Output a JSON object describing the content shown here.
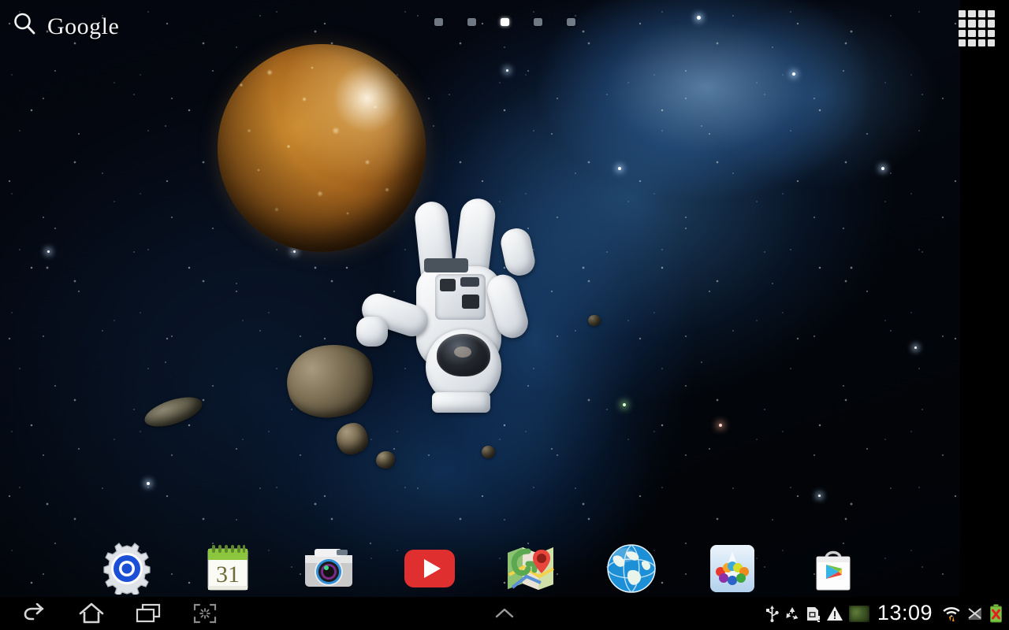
{
  "wallpaper": {
    "name": "space-astronaut-live-wallpaper",
    "scene_elements": [
      "blue-nebula",
      "star-field",
      "cratered-golden-moon",
      "floating-astronaut",
      "asteroids"
    ]
  },
  "search_widget": {
    "icon": "search-icon",
    "brand": "Google"
  },
  "home": {
    "page_count": 5,
    "active_page": 3,
    "apps_button_icon": "apps-grid-icon"
  },
  "dock": {
    "apps": [
      {
        "label": "Settings",
        "icon": "settings-gear-icon"
      },
      {
        "label": "S Planner",
        "icon": "calendar-icon",
        "day": "31"
      },
      {
        "label": "Camera",
        "icon": "camera-icon"
      },
      {
        "label": "YouTube",
        "icon": "youtube-icon"
      },
      {
        "label": "Maps",
        "icon": "maps-icon"
      },
      {
        "label": "Internet",
        "icon": "globe-browser-icon"
      },
      {
        "label": "Samsung Ap",
        "icon": "samsung-apps-icon"
      },
      {
        "label": "Play Store",
        "icon": "play-store-icon"
      }
    ]
  },
  "system_bar": {
    "nav": [
      {
        "name": "back",
        "icon": "back-arrow-icon"
      },
      {
        "name": "home",
        "icon": "home-icon"
      },
      {
        "name": "recents",
        "icon": "recent-apps-icon"
      },
      {
        "name": "screenshot",
        "icon": "screen-capture-icon"
      }
    ],
    "center_icon": "chevron-up-icon",
    "status_icons": [
      "usb-icon",
      "recycle-icon",
      "sd-card-alert-icon",
      "warning-triangle-icon",
      "photo-thumbnail-icon"
    ],
    "clock": "13:09",
    "connectivity_icons": [
      "wifi-data-transfer-icon",
      "mobile-signal-off-icon",
      "battery-error-icon"
    ]
  },
  "colors": {
    "nebula_blue": "#2f7fd0",
    "moon_gold": "#b8791f",
    "youtube_red": "#e02f2f",
    "battery_green": "#7dc242",
    "battery_error_red": "#e02020",
    "accent_white": "#ffffff"
  }
}
